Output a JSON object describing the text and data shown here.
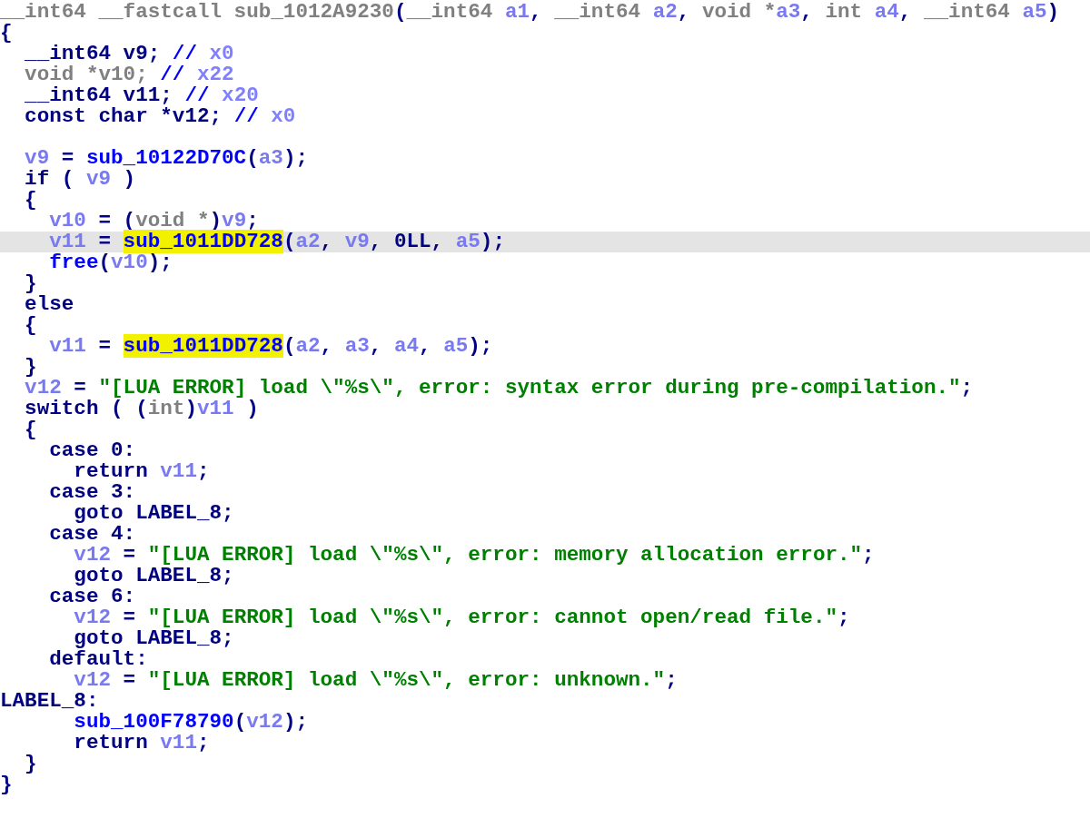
{
  "code_lines": [
    {
      "current": false,
      "tokens": [
        {
          "kind": "type",
          "text": "__int64 __fastcall sub_1012A9230"
        },
        {
          "kind": "plain",
          "text": "("
        },
        {
          "kind": "type",
          "text": "__int64 "
        },
        {
          "kind": "variable",
          "text": "a1"
        },
        {
          "kind": "plain",
          "text": ", "
        },
        {
          "kind": "type",
          "text": "__int64 "
        },
        {
          "kind": "variable",
          "text": "a2"
        },
        {
          "kind": "plain",
          "text": ", "
        },
        {
          "kind": "type",
          "text": "void *"
        },
        {
          "kind": "variable",
          "text": "a3"
        },
        {
          "kind": "plain",
          "text": ", "
        },
        {
          "kind": "type",
          "text": "int "
        },
        {
          "kind": "variable",
          "text": "a4"
        },
        {
          "kind": "plain",
          "text": ", "
        },
        {
          "kind": "type",
          "text": "__int64 "
        },
        {
          "kind": "variable",
          "text": "a5"
        },
        {
          "kind": "plain",
          "text": ")"
        }
      ]
    },
    {
      "current": false,
      "tokens": [
        {
          "kind": "plain",
          "text": "{"
        }
      ]
    },
    {
      "current": false,
      "tokens": [
        {
          "kind": "plain",
          "text": "  __int64 v9; "
        },
        {
          "kind": "comment",
          "text": "// "
        },
        {
          "kind": "note",
          "text": "x0"
        }
      ]
    },
    {
      "current": false,
      "tokens": [
        {
          "kind": "type",
          "text": "  void *v10; "
        },
        {
          "kind": "comment",
          "text": "// "
        },
        {
          "kind": "note",
          "text": "x22"
        }
      ]
    },
    {
      "current": false,
      "tokens": [
        {
          "kind": "plain",
          "text": "  __int64 v11; "
        },
        {
          "kind": "comment",
          "text": "// "
        },
        {
          "kind": "note",
          "text": "x20"
        }
      ]
    },
    {
      "current": false,
      "tokens": [
        {
          "kind": "plain",
          "text": "  const char *v12; "
        },
        {
          "kind": "comment",
          "text": "// "
        },
        {
          "kind": "note",
          "text": "x0"
        }
      ]
    },
    {
      "current": false
    },
    {
      "current": false,
      "tokens": [
        {
          "kind": "variable",
          "text": "  v9"
        },
        {
          "kind": "plain",
          "text": " = "
        },
        {
          "kind": "function",
          "text": "sub_10122D70C"
        },
        {
          "kind": "plain",
          "text": "("
        },
        {
          "kind": "variable",
          "text": "a3"
        },
        {
          "kind": "plain",
          "text": ");"
        }
      ]
    },
    {
      "current": false,
      "tokens": [
        {
          "kind": "plain",
          "text": "  if ( "
        },
        {
          "kind": "variable",
          "text": "v9"
        },
        {
          "kind": "plain",
          "text": " )"
        }
      ]
    },
    {
      "current": false,
      "tokens": [
        {
          "kind": "plain",
          "text": "  {"
        }
      ]
    },
    {
      "current": false,
      "tokens": [
        {
          "kind": "variable",
          "text": "    v10"
        },
        {
          "kind": "plain",
          "text": " = ("
        },
        {
          "kind": "type",
          "text": "void *"
        },
        {
          "kind": "plain",
          "text": ")"
        },
        {
          "kind": "variable",
          "text": "v9"
        },
        {
          "kind": "plain",
          "text": ";"
        }
      ]
    },
    {
      "current": true,
      "tokens": [
        {
          "kind": "variable",
          "text": "    v11"
        },
        {
          "kind": "plain",
          "text": " = "
        },
        {
          "kind": "highlight",
          "text": "sub_1011DD728"
        },
        {
          "kind": "plain",
          "text": "("
        },
        {
          "kind": "variable",
          "text": "a2"
        },
        {
          "kind": "plain",
          "text": ", "
        },
        {
          "kind": "variable",
          "text": "v9"
        },
        {
          "kind": "plain",
          "text": ", 0LL, "
        },
        {
          "kind": "variable",
          "text": "a5"
        },
        {
          "kind": "plain",
          "text": ");"
        }
      ]
    },
    {
      "current": false,
      "tokens": [
        {
          "kind": "function",
          "text": "    free"
        },
        {
          "kind": "plain",
          "text": "("
        },
        {
          "kind": "variable",
          "text": "v10"
        },
        {
          "kind": "plain",
          "text": ");"
        }
      ]
    },
    {
      "current": false,
      "tokens": [
        {
          "kind": "plain",
          "text": "  }"
        }
      ]
    },
    {
      "current": false,
      "tokens": [
        {
          "kind": "plain",
          "text": "  else"
        }
      ]
    },
    {
      "current": false,
      "tokens": [
        {
          "kind": "plain",
          "text": "  {"
        }
      ]
    },
    {
      "current": false,
      "tokens": [
        {
          "kind": "variable",
          "text": "    v11"
        },
        {
          "kind": "plain",
          "text": " = "
        },
        {
          "kind": "highlight",
          "text": "sub_1011DD728"
        },
        {
          "kind": "plain",
          "text": "("
        },
        {
          "kind": "variable",
          "text": "a2"
        },
        {
          "kind": "plain",
          "text": ", "
        },
        {
          "kind": "variable",
          "text": "a3"
        },
        {
          "kind": "plain",
          "text": ", "
        },
        {
          "kind": "variable",
          "text": "a4"
        },
        {
          "kind": "plain",
          "text": ", "
        },
        {
          "kind": "variable",
          "text": "a5"
        },
        {
          "kind": "plain",
          "text": ");"
        }
      ]
    },
    {
      "current": false,
      "tokens": [
        {
          "kind": "plain",
          "text": "  }"
        }
      ]
    },
    {
      "current": false,
      "tokens": [
        {
          "kind": "variable",
          "text": "  v12"
        },
        {
          "kind": "plain",
          "text": " = "
        },
        {
          "kind": "string",
          "text": "\"[LUA ERROR] load \\\"%s\\\", error: syntax error during pre-compilation.\""
        },
        {
          "kind": "plain",
          "text": ";"
        }
      ]
    },
    {
      "current": false,
      "tokens": [
        {
          "kind": "plain",
          "text": "  switch ( ("
        },
        {
          "kind": "type",
          "text": "int"
        },
        {
          "kind": "plain",
          "text": ")"
        },
        {
          "kind": "variable",
          "text": "v11"
        },
        {
          "kind": "plain",
          "text": " )"
        }
      ]
    },
    {
      "current": false,
      "tokens": [
        {
          "kind": "plain",
          "text": "  {"
        }
      ]
    },
    {
      "current": false,
      "tokens": [
        {
          "kind": "plain",
          "text": "    case 0:"
        }
      ]
    },
    {
      "current": false,
      "tokens": [
        {
          "kind": "plain",
          "text": "      return "
        },
        {
          "kind": "variable",
          "text": "v11"
        },
        {
          "kind": "plain",
          "text": ";"
        }
      ]
    },
    {
      "current": false,
      "tokens": [
        {
          "kind": "plain",
          "text": "    case 3:"
        }
      ]
    },
    {
      "current": false,
      "tokens": [
        {
          "kind": "plain",
          "text": "      goto LABEL_8;"
        }
      ]
    },
    {
      "current": false,
      "tokens": [
        {
          "kind": "plain",
          "text": "    case 4:"
        }
      ]
    },
    {
      "current": false,
      "tokens": [
        {
          "kind": "variable",
          "text": "      v12"
        },
        {
          "kind": "plain",
          "text": " = "
        },
        {
          "kind": "string",
          "text": "\"[LUA ERROR] load \\\"%s\\\", error: memory allocation error.\""
        },
        {
          "kind": "plain",
          "text": ";"
        }
      ]
    },
    {
      "current": false,
      "tokens": [
        {
          "kind": "plain",
          "text": "      goto LABEL_8;"
        }
      ]
    },
    {
      "current": false,
      "tokens": [
        {
          "kind": "plain",
          "text": "    case 6:"
        }
      ]
    },
    {
      "current": false,
      "tokens": [
        {
          "kind": "variable",
          "text": "      v12"
        },
        {
          "kind": "plain",
          "text": " = "
        },
        {
          "kind": "string",
          "text": "\"[LUA ERROR] load \\\"%s\\\", error: cannot open/read file.\""
        },
        {
          "kind": "plain",
          "text": ";"
        }
      ]
    },
    {
      "current": false,
      "tokens": [
        {
          "kind": "plain",
          "text": "      goto LABEL_8;"
        }
      ]
    },
    {
      "current": false,
      "tokens": [
        {
          "kind": "plain",
          "text": "    default:"
        }
      ]
    },
    {
      "current": false,
      "tokens": [
        {
          "kind": "variable",
          "text": "      v12"
        },
        {
          "kind": "plain",
          "text": " = "
        },
        {
          "kind": "string",
          "text": "\"[LUA ERROR] load \\\"%s\\\", error: unknown.\""
        },
        {
          "kind": "plain",
          "text": ";"
        }
      ]
    },
    {
      "current": false,
      "tokens": [
        {
          "kind": "plain",
          "text": "LABEL_8:"
        }
      ]
    },
    {
      "current": false,
      "tokens": [
        {
          "kind": "function",
          "text": "      sub_100F78790"
        },
        {
          "kind": "plain",
          "text": "("
        },
        {
          "kind": "variable",
          "text": "v12"
        },
        {
          "kind": "plain",
          "text": ");"
        }
      ]
    },
    {
      "current": false,
      "tokens": [
        {
          "kind": "plain",
          "text": "      return "
        },
        {
          "kind": "variable",
          "text": "v11"
        },
        {
          "kind": "plain",
          "text": ";"
        }
      ]
    },
    {
      "current": false,
      "tokens": [
        {
          "kind": "plain",
          "text": "  }"
        }
      ]
    },
    {
      "current": false,
      "tokens": [
        {
          "kind": "plain",
          "text": "}"
        }
      ]
    }
  ]
}
